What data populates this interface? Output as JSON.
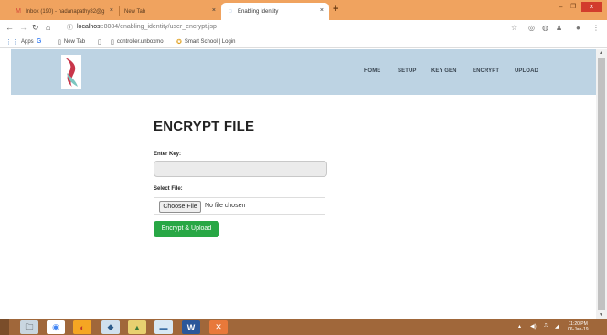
{
  "browser": {
    "tabs": [
      {
        "label": "Inbox (190) - nadanapathy82@g",
        "icon": "gmail-icon",
        "close": "×"
      },
      {
        "label": "New Tab",
        "icon": "blank-icon",
        "close": "×"
      },
      {
        "label": "Enabling Identity",
        "icon": "loading-icon",
        "close": "×"
      }
    ],
    "new_tab": "+",
    "window_controls": {
      "minimize": "–",
      "maximize": "❐",
      "close": "×"
    },
    "url": {
      "host": "localhost",
      "path": ":8084/enabling_identity/user_encrypt.jsp"
    },
    "bookmarks": [
      {
        "label": "Apps",
        "icon": "apps-icon"
      },
      {
        "label": "",
        "icon": "google-icon"
      },
      {
        "label": "New Tab",
        "icon": "page-icon"
      },
      {
        "label": "",
        "icon": "page-icon"
      },
      {
        "label": "controller.unboxmo",
        "icon": "page-icon"
      },
      {
        "label": "Smart School | Login",
        "icon": "school-icon"
      }
    ]
  },
  "site": {
    "nav": [
      {
        "label": "HOME"
      },
      {
        "label": "SETUP"
      },
      {
        "label": "KEY GEN"
      },
      {
        "label": "ENCRYPT"
      },
      {
        "label": "UPLOAD"
      }
    ],
    "brand_colors": {
      "header_bg": "#bdd3e3",
      "logo_red": "#c8364a",
      "logo_teal": "#7cc6c0",
      "button_green": "#28a745"
    }
  },
  "form": {
    "title": "ENCRYPT FILE",
    "key_label": "Enter Key:",
    "key_value": "",
    "file_label": "Select File:",
    "choose_button": "Choose File",
    "no_file_text": "No file chosen",
    "submit_label": "Encrypt & Upload"
  },
  "taskbar": {
    "clock_time": "11:20 PM",
    "clock_date": "06-Jan-19"
  }
}
